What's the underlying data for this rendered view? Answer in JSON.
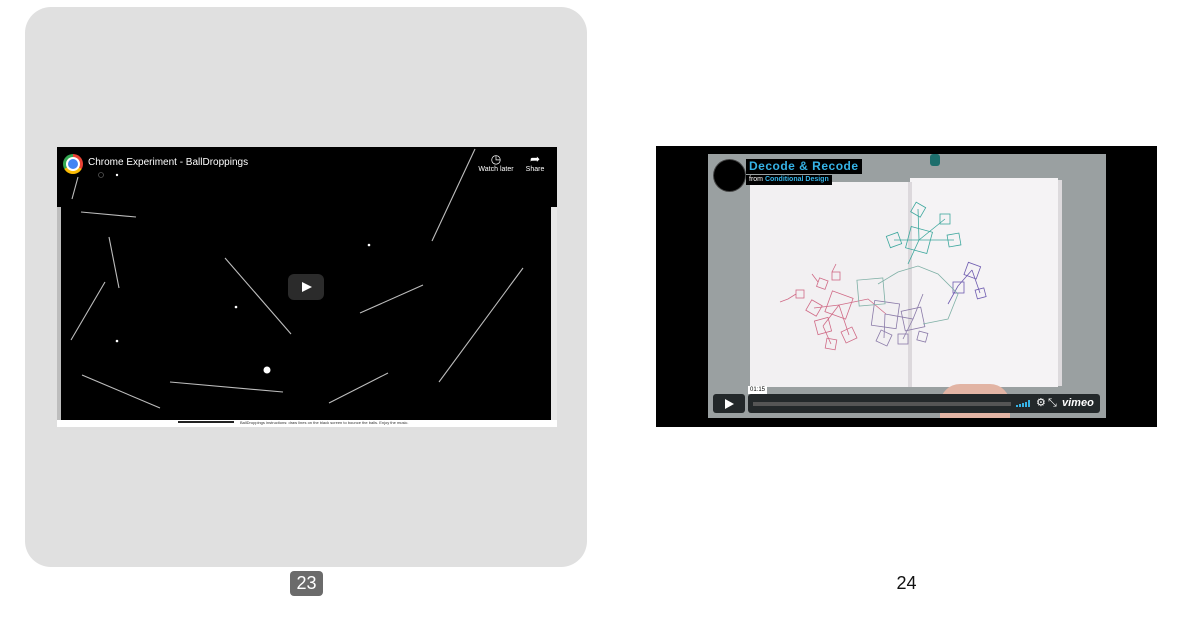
{
  "slide_left": {
    "number": "23",
    "video": {
      "title": "Chrome Experiment - BallDroppings",
      "watch_later_label": "Watch later",
      "share_label": "Share",
      "instructions": "BallDroppings instructions: draw lines on the black screen to bounce the balls. Enjoy the music."
    }
  },
  "slide_right": {
    "number": "24",
    "video": {
      "title": "Decode & Recode",
      "from_label": "from",
      "from_link": "Conditional Design",
      "time": "01:15",
      "brand": "vimeo"
    }
  },
  "colors": {
    "selected_card_bg": "#e0e0e0",
    "page_badge_bg": "#6b6b6b",
    "vimeo_accent": "#36b3e6"
  },
  "icons": [
    "chrome-logo",
    "clock-icon",
    "share-icon",
    "play-icon",
    "volume-icon",
    "settings-icon",
    "fullscreen-icon"
  ]
}
